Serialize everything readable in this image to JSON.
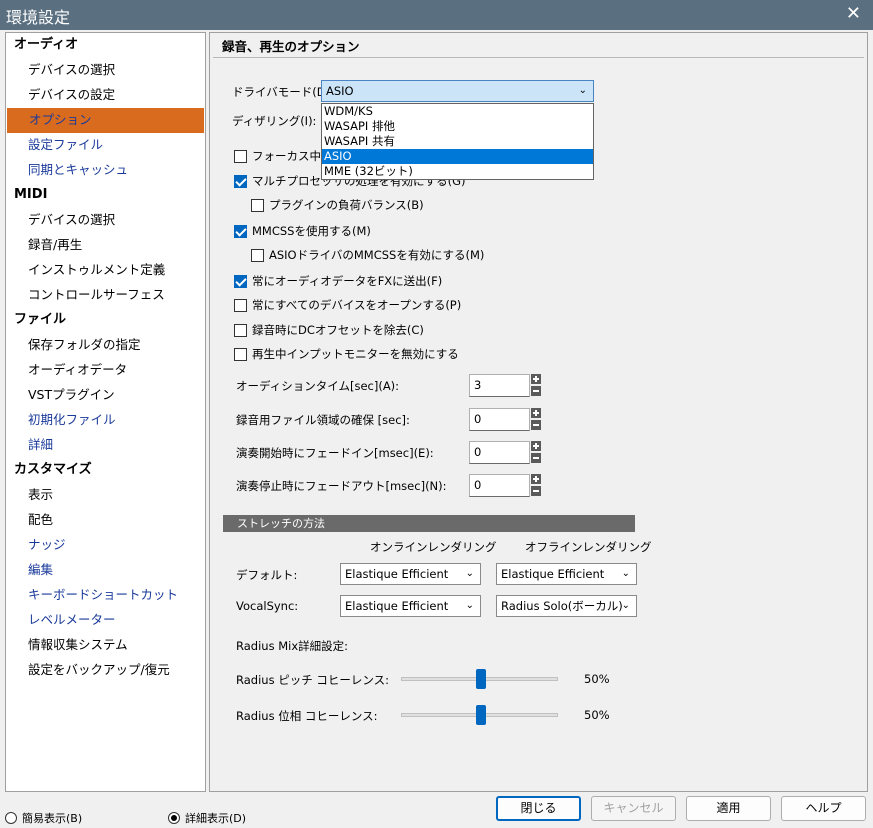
{
  "window": {
    "title": "環境設定",
    "close": "✕"
  },
  "sidebar": {
    "items": [
      {
        "label": "オーディオ",
        "type": "hdr"
      },
      {
        "label": "デバイスの選択",
        "type": "sub"
      },
      {
        "label": "デバイスの設定",
        "type": "sub"
      },
      {
        "label": "オプション",
        "type": "sub",
        "state": "selected"
      },
      {
        "label": "設定ファイル",
        "type": "sub",
        "color": "blue"
      },
      {
        "label": "同期とキャッシュ",
        "type": "sub",
        "color": "blue"
      },
      {
        "label": "MIDI",
        "type": "hdr"
      },
      {
        "label": "デバイスの選択",
        "type": "sub"
      },
      {
        "label": "録音/再生",
        "type": "sub"
      },
      {
        "label": "インストゥルメント定義",
        "type": "sub"
      },
      {
        "label": "コントロールサーフェス",
        "type": "sub"
      },
      {
        "label": "ファイル",
        "type": "hdr"
      },
      {
        "label": "保存フォルダの指定",
        "type": "sub"
      },
      {
        "label": "オーディオデータ",
        "type": "sub"
      },
      {
        "label": "VSTプラグイン",
        "type": "sub"
      },
      {
        "label": "初期化ファイル",
        "type": "sub",
        "color": "blue"
      },
      {
        "label": "詳細",
        "type": "sub",
        "color": "blue"
      },
      {
        "label": "カスタマイズ",
        "type": "hdr"
      },
      {
        "label": "表示",
        "type": "sub"
      },
      {
        "label": "配色",
        "type": "sub"
      },
      {
        "label": "ナッジ",
        "type": "sub",
        "color": "blue"
      },
      {
        "label": "編集",
        "type": "sub",
        "color": "blue"
      },
      {
        "label": "キーボードショートカット",
        "type": "sub",
        "color": "blue"
      },
      {
        "label": "レベルメーター",
        "type": "sub",
        "color": "blue"
      },
      {
        "label": "情報収集システム",
        "type": "sub"
      },
      {
        "label": "設定をバックアップ/復元",
        "type": "sub"
      }
    ]
  },
  "main": {
    "section_title": "録音、再生のオプション",
    "driver_mode": {
      "label": "ドライバモード(D):",
      "value": "ASIO",
      "options": [
        "WDM/KS",
        "WASAPI 排他",
        "WASAPI 共有",
        "ASIO",
        "MME (32ビット)"
      ],
      "highlighted": "ASIO"
    },
    "dithering": {
      "label": "ディザリング(I):"
    },
    "checks": [
      {
        "label": "フォーカス中でな",
        "checked": false
      },
      {
        "label": "マルチプロセッサの処理を有効にする(G)",
        "checked": true
      },
      {
        "label": "プラグインの負荷バランス(B)",
        "checked": false
      },
      {
        "label": "MMCSSを使用する(M)",
        "checked": true
      },
      {
        "label": "ASIOドライバのMMCSSを有効にする(M)",
        "checked": false
      },
      {
        "label": "常にオーディオデータをFXに送出(F)",
        "checked": true
      },
      {
        "label": "常にすべてのデバイスをオープンする(P)",
        "checked": false
      },
      {
        "label": "録音時にDCオフセットを除去(C)",
        "checked": false
      },
      {
        "label": "再生中インプットモニターを無効にする",
        "checked": false
      }
    ],
    "numbers": [
      {
        "label": "オーディションタイム[sec](A):",
        "value": "3"
      },
      {
        "label": "録音用ファイル領域の確保 [sec]:",
        "value": "0"
      },
      {
        "label": "演奏開始時にフェードイン[msec](E):",
        "value": "0"
      },
      {
        "label": "演奏停止時にフェードアウト[msec](N):",
        "value": "0"
      }
    ],
    "stretch": {
      "title": "ストレッチの方法",
      "col_online": "オンラインレンダリング",
      "col_offline": "オフラインレンダリング",
      "rows": [
        {
          "label": "デフォルト:",
          "online": "Elastique Efficient",
          "offline": "Elastique Efficient"
        },
        {
          "label": "VocalSync:",
          "online": "Elastique Efficient",
          "offline": "Radius Solo(ボーカル)"
        }
      ]
    },
    "radius": {
      "title": "Radius Mix詳細設定:",
      "sliders": [
        {
          "label": "Radius ピッチ コヒーレンス:",
          "value": "50%",
          "level": 0.5
        },
        {
          "label": "Radius 位相 コヒーレンス:",
          "value": "50%",
          "level": 0.5
        }
      ]
    }
  },
  "bottom": {
    "simple": "簡易表示(B)",
    "detail": "詳細表示(D)",
    "mode": "detail",
    "buttons": {
      "close": "閉じる",
      "cancel": "キャンセル",
      "apply": "適用",
      "help": "ヘルプ"
    }
  },
  "colors": {
    "selected_bg": "#d96b1f",
    "link": "#1a3a9a",
    "accent": "#0067c0"
  }
}
